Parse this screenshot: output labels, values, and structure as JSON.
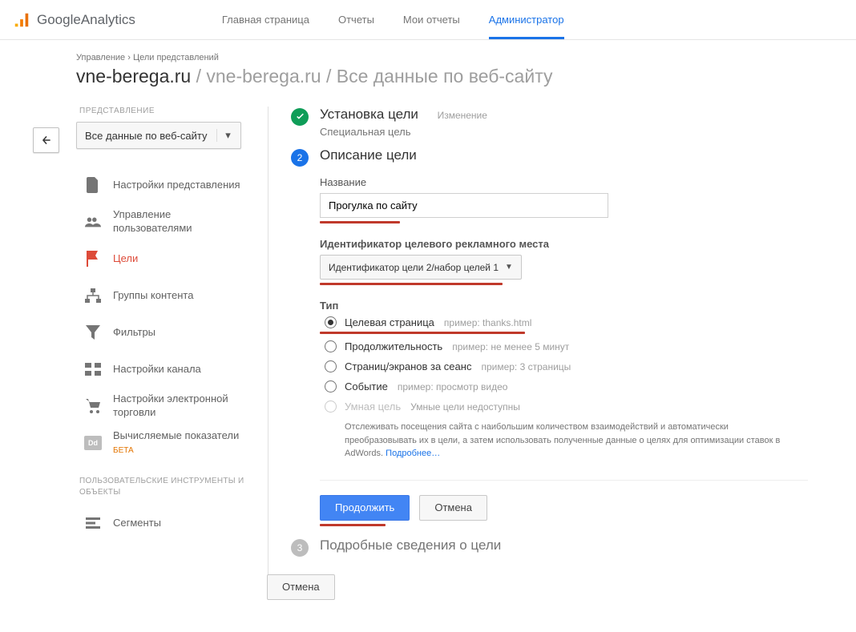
{
  "brand": {
    "g": "Google",
    "a": " Analytics"
  },
  "nav": {
    "home": "Главная страница",
    "reports": "Отчеты",
    "my_reports": "Мои отчеты",
    "admin": "Администратор"
  },
  "breadcrumb": {
    "a": "Управление",
    "b": "Цели представлений"
  },
  "title": {
    "main": "vne-berega.ru",
    "sub": " / vne-berega.ru / Все данные по веб-сайту"
  },
  "sidebar": {
    "section_label": "ПРЕДСТАВЛЕНИЕ",
    "view_selector": "Все данные по веб-сайту",
    "items": [
      {
        "label": "Настройки представления"
      },
      {
        "label": "Управление пользователями"
      },
      {
        "label": "Цели"
      },
      {
        "label": "Группы контента"
      },
      {
        "label": "Фильтры"
      },
      {
        "label": "Настройки канала"
      },
      {
        "label": "Настройки электронной торговли"
      },
      {
        "label": "Вычисляемые показатели",
        "beta": "БЕТА"
      }
    ],
    "tools_heading": "ПОЛЬЗОВАТЕЛЬСКИЕ ИНСТРУМЕНТЫ И ОБЪЕКТЫ",
    "segments": "Сегменты",
    "dd_badge": "Dd"
  },
  "steps": {
    "s1": {
      "title": "Установка цели",
      "edit": "Изменение",
      "subtitle": "Специальная цель"
    },
    "s2": {
      "num": "2",
      "title": "Описание цели",
      "name_label": "Название",
      "name_value": "Прогулка по сайту",
      "slot_label": "Идентификатор целевого рекламного места",
      "slot_value": "Идентификатор цели 2/набор целей 1",
      "type_label": "Тип",
      "types": [
        {
          "label": "Целевая страница",
          "example": "пример: thanks.html"
        },
        {
          "label": "Продолжительность",
          "example": "пример: не менее 5 минут"
        },
        {
          "label": "Страниц/экранов за сеанс",
          "example": "пример: 3 страницы"
        },
        {
          "label": "Событие",
          "example": "пример: просмотр видео"
        },
        {
          "label": "Умная цель",
          "example": "Умные цели недоступны"
        }
      ],
      "smart_desc": "Отслеживать посещения сайта с наибольшим количеством взаимодействий и автоматически преобразовывать их в цели, а затем использовать полученные данные о целях для оптимизации ставок в AdWords.",
      "smart_more": "Подробнее…",
      "continue_btn": "Продолжить",
      "cancel_btn": "Отмена"
    },
    "s3": {
      "num": "3",
      "title": "Подробные сведения о цели"
    },
    "bottom_cancel": "Отмена"
  }
}
